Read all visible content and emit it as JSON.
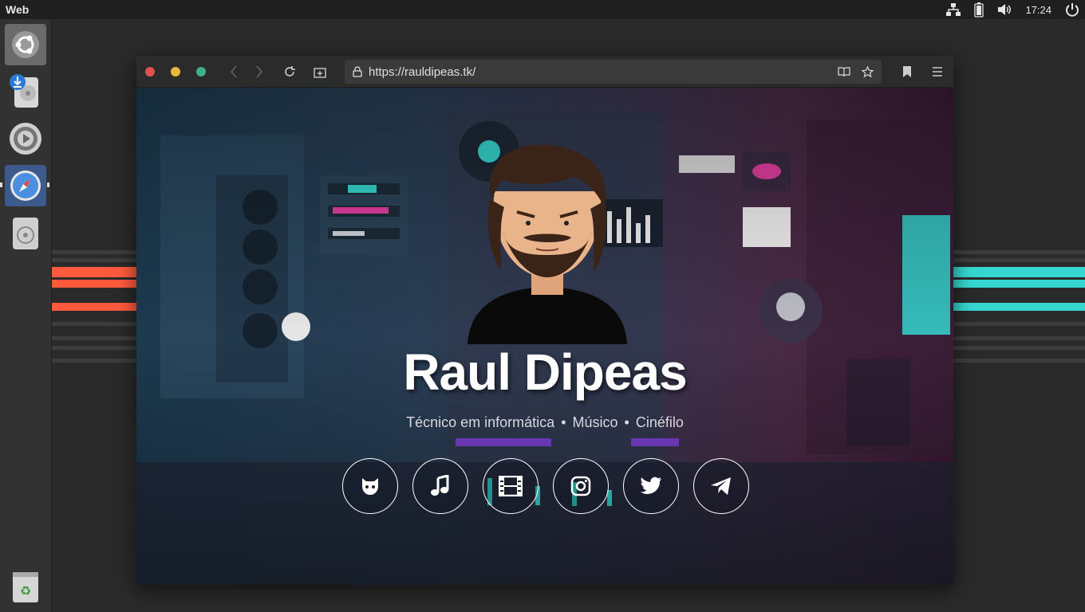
{
  "top_panel": {
    "app_name": "Web",
    "clock": "17:24",
    "icons": [
      "network-icon",
      "battery-icon",
      "volume-icon",
      "power-icon"
    ]
  },
  "launcher": {
    "items": [
      {
        "name": "ubuntu-dash-icon"
      },
      {
        "name": "software-updater-icon"
      },
      {
        "name": "system-settings-icon"
      },
      {
        "name": "web-browser-icon",
        "active": true
      },
      {
        "name": "disk-icon"
      },
      {
        "name": "trash-icon"
      }
    ]
  },
  "browser": {
    "url": "https://rauldipeas.tk/",
    "toolbar_icons": [
      "back-icon",
      "forward-icon",
      "reload-icon",
      "new-tab-icon",
      "reader-icon",
      "star-icon",
      "bookmark-icon",
      "menu-icon"
    ]
  },
  "page": {
    "name": "Raul Dipeas",
    "subtitle_items": [
      "Técnico em informática",
      "Músico",
      "Cinéfilo"
    ],
    "separator": "•",
    "socials": [
      "github-icon",
      "music-icon",
      "film-icon",
      "instagram-icon",
      "twitter-icon",
      "telegram-icon"
    ]
  },
  "colors": {
    "close": "#e05252",
    "minimize": "#e8b93a",
    "maximize": "#3fae8c",
    "accent_left": "#ff5a3c",
    "accent_right": "#35d7d0"
  }
}
